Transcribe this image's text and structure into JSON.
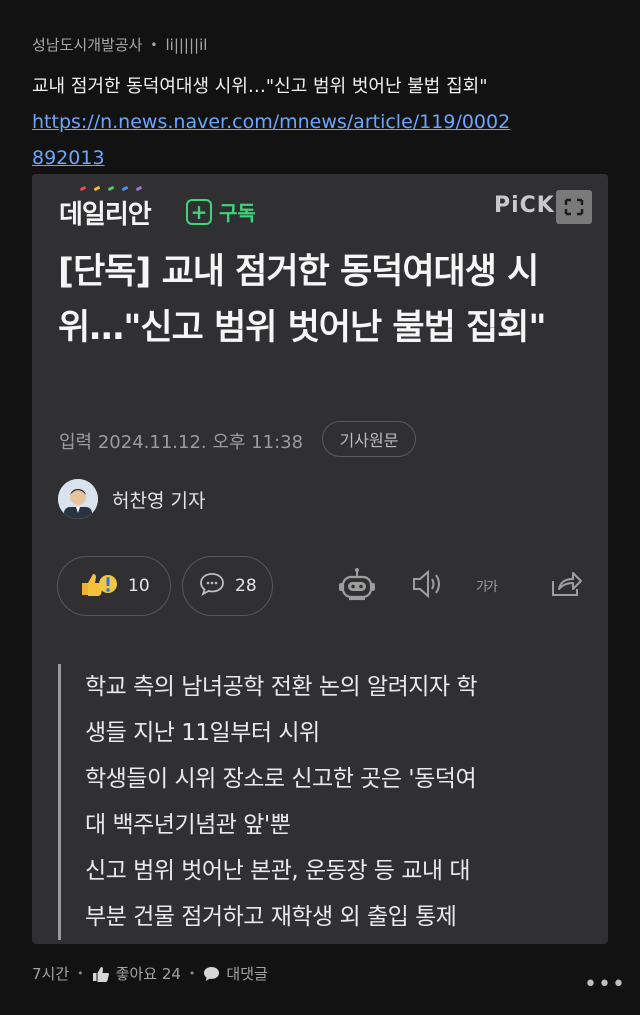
{
  "post": {
    "source": "성남도시개발공사",
    "level": "li|||||il",
    "title": "교내 점거한 동덕여대생 시위…\"신고 범위 벗어난 불법 집회\"",
    "link": "https://n.news.naver.com/mnews/article/119/0002892013"
  },
  "card": {
    "publisher": "데일리안",
    "subscribe": "구독",
    "pick": "PiCK",
    "headline": "[단독] 교내 점거한 동덕여대생 시위…\"신고 범위 벗어난 불법 집회\"",
    "dateline": "입력 2024.11.12. 오후 11:38",
    "original_button": "기사원문",
    "reporter": "허찬영 기자",
    "reactions": "10",
    "comments": "28",
    "font_size_label": "가가",
    "summary": [
      "학교 측의 남녀공학 전환 논의 알려지자 학",
      "생들 지난 11일부터 시위",
      "학생들이 시위 장소로 신고한 곳은 '동덕여",
      "대 백주년기념관 앞'뿐",
      "신고 범위 벗어난 본관, 운동장 등 교내 대",
      "부분 건물 점거하고 재학생 외 출입 통제"
    ]
  },
  "footer": {
    "time": "7시간",
    "likes": "좋아요 24",
    "reply": "대댓글",
    "more": "•••"
  },
  "colors": {
    "background": "#121212",
    "card": "#303033",
    "accent_green": "#3fd47a",
    "link": "#6aa6ff"
  }
}
